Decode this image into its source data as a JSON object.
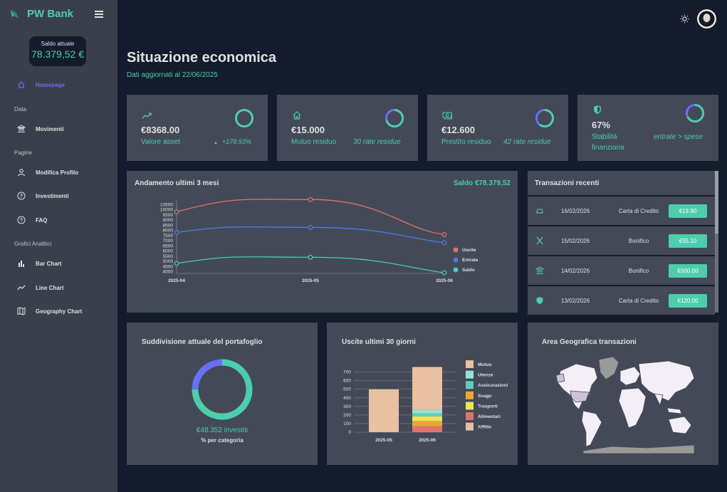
{
  "app": {
    "name": "PW Bank"
  },
  "sidebar": {
    "balance_label": "Saldo attuale",
    "balance_value": "78.379,52 €",
    "items": [
      {
        "label": "Homepage",
        "icon": "home-icon",
        "active": true
      },
      {
        "section": "Data"
      },
      {
        "label": "Movimenti",
        "icon": "bank-icon"
      },
      {
        "section": "Pagine"
      },
      {
        "label": "Modifica Profilo",
        "icon": "user-icon"
      },
      {
        "label": "Investimenti",
        "icon": "help-icon"
      },
      {
        "label": "FAQ",
        "icon": "help-icon"
      },
      {
        "section": "Grafici Analitici"
      },
      {
        "label": "Bar Chart",
        "icon": "bar-chart-icon"
      },
      {
        "label": "Line Chart",
        "icon": "line-chart-icon"
      },
      {
        "label": "Geography Chart",
        "icon": "map-icon"
      }
    ]
  },
  "header": {
    "title": "Situazione economica",
    "subtitle": "Dati aggiornati al 22/06/2025"
  },
  "stats": [
    {
      "value": "€8368.00",
      "label": "Valore asset",
      "extra": "+178.93%",
      "icon": "trending-up-icon",
      "progress": 1.0
    },
    {
      "value": "€15.000",
      "label": "Mutuo residuo",
      "extra": "30 rate residue",
      "icon": "home-icon",
      "progress": 0.7
    },
    {
      "value": "€12.600",
      "label": "Prestito residuo",
      "extra": "42 rate residue",
      "icon": "cash-icon",
      "progress": 0.6
    },
    {
      "value": "67%",
      "label": "Stabilità finanziaria",
      "extra": "entrate > spese",
      "icon": "shield-icon",
      "progress": 0.67
    }
  ],
  "line_card": {
    "title": "Andamento ultimi 3 mesi",
    "saldo": "Saldo €78.379,52"
  },
  "transactions": {
    "title": "Transazioni recenti",
    "rows": [
      {
        "date": "16/02/2026",
        "type": "Carta di Credito",
        "amount": "€19.90",
        "icon": "car-icon"
      },
      {
        "date": "15/02/2026",
        "type": "Bonifico",
        "amount": "€55.10",
        "icon": "utensils-icon"
      },
      {
        "date": "14/02/2026",
        "type": "Bonifico",
        "amount": "€500.00",
        "icon": "bank-icon"
      },
      {
        "date": "13/02/2026",
        "type": "Carta di Credito",
        "amount": "€120.00",
        "icon": "shield-icon"
      }
    ]
  },
  "portfolio": {
    "title": "Suddivisione attuale del portafoglio",
    "amount": "€48.352 investiti",
    "caption": "% per categoria"
  },
  "expenses": {
    "title": "Uscite ultimi 30 giorni"
  },
  "geo": {
    "title": "Area Geografica transazioni"
  },
  "colors": {
    "accent": "#4cceac",
    "primary": "#6870fa",
    "card": "#434957",
    "bg": "#141b2d",
    "uscite": "#e2726e",
    "entrate": "#4e7ce6"
  },
  "chart_data": [
    {
      "type": "line",
      "x": [
        "2025-04",
        "2025-05",
        "2025-06"
      ],
      "yticks": [
        4000,
        4500,
        5000,
        5500,
        6000,
        6500,
        7000,
        7500,
        8000,
        8500,
        9000,
        9500,
        10000,
        10500
      ],
      "ylim": [
        3900,
        10600
      ],
      "series": [
        {
          "name": "Uscite",
          "values": [
            9800,
            11000,
            7600
          ],
          "color": "#e2726e"
        },
        {
          "name": "Entrate",
          "values": [
            7800,
            8300,
            6800
          ],
          "color": "#4e7ce6"
        },
        {
          "name": "Saldo",
          "values": [
            4800,
            5400,
            3900
          ],
          "color": "#4cceac"
        }
      ],
      "legend": "right"
    },
    {
      "type": "bar",
      "categories": [
        "2025-05",
        "2025-06"
      ],
      "yticks": [
        0,
        100,
        200,
        300,
        400,
        500,
        600,
        700
      ],
      "ylim": [
        0,
        780
      ],
      "series": [
        {
          "name": "Affitto",
          "values": [
            500,
            0
          ],
          "color": "#e8c1a0"
        },
        {
          "name": "Alimentari",
          "values": [
            0,
            70
          ],
          "color": "#e2726e"
        },
        {
          "name": "Trasporti",
          "values": [
            0,
            60
          ],
          "color": "#e8a838"
        },
        {
          "name": "Svago",
          "values": [
            0,
            55
          ],
          "color": "#f1e15b"
        },
        {
          "name": "Assicurazioni",
          "values": [
            0,
            35
          ],
          "color": "#61cdbb"
        },
        {
          "name": "Utenze",
          "values": [
            0,
            40
          ],
          "color": "#97e3d5"
        },
        {
          "name": "Mutuo",
          "values": [
            0,
            500
          ],
          "color": "#e8c1a0"
        }
      ],
      "legend": [
        "Mutuo",
        "Utenze",
        "Assicurazioni",
        "Svago",
        "Trasporti",
        "Alimentari",
        "Affitto"
      ],
      "legend_colors": [
        "#e8c1a0",
        "#97e3d5",
        "#61cdbb",
        "#e8a838",
        "#f1e15b",
        "#e2726e",
        "#e8c1a0"
      ]
    },
    {
      "type": "pie",
      "values": [
        75,
        25
      ],
      "colors": [
        "#4cceac",
        "#6870fa"
      ]
    }
  ]
}
